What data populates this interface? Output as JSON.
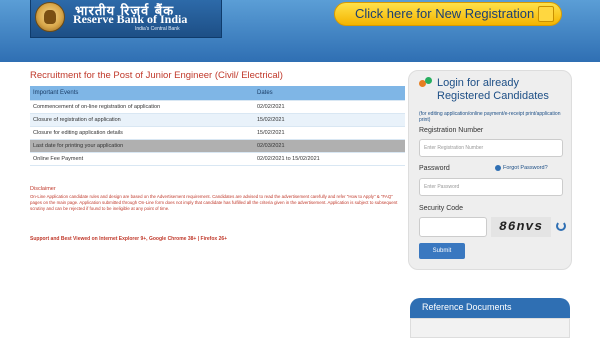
{
  "header": {
    "logo_hindi": "भारतीय रिज़र्व बैंक",
    "logo_english": "Reserve Bank of India",
    "logo_tagline": "India's Central Bank",
    "registration_button": "Click here for New Registration"
  },
  "main": {
    "title": "Recruitment for the Post of Junior Engineer (Civil/ Electrical)",
    "table": {
      "headers": [
        "Important Events",
        "Dates"
      ],
      "rows": [
        [
          "Commencement of on-line registration of application",
          "02/02/2021"
        ],
        [
          "Closure of registration of application",
          "15/02/2021"
        ],
        [
          "Closure for editing application details",
          "15/02/2021"
        ],
        [
          "Last date for printing your application",
          "02/03/2021"
        ],
        [
          "Online Fee Payment",
          "02/02/2021 to 15/02/2021"
        ]
      ]
    },
    "disclaimer_title": "Disclaimer",
    "disclaimer_text": "On-Line Application candidate rules and design are based on the Advertisement requirement. Candidates are advised to read the advertisement carefully and refer \"How to Apply\" & \"FAQ\" pages on the main page. Application submitted through On-Line form does not imply that candidate has fulfilled all the criteria given in the advertisement. Application is subject to subsequent scrutiny and can be rejected if found to be ineligible at any point of time.",
    "browser_note": "Support and Best Viewed on Internet Explorer 9+, Google Chrome 38+ | Firefox 26+"
  },
  "login": {
    "title": "Login for already Registered Candidates",
    "note": "(for editing application/online payment/e-receipt print/application print)",
    "reg_label": "Registration Number",
    "reg_placeholder": "Enter Registration Number",
    "password_label": "Password",
    "forgot": "Forgot Password?",
    "password_placeholder": "Enter Password",
    "captcha_label": "Security Code",
    "captcha_text": "86nvs",
    "submit": "Submit"
  },
  "reference": {
    "title": "Reference Documents"
  },
  "colors": {
    "header_blue": "#2f6fb3",
    "button_yellow": "#f4b400",
    "title_red": "#c0392b",
    "table_header": "#7fb6e6"
  }
}
